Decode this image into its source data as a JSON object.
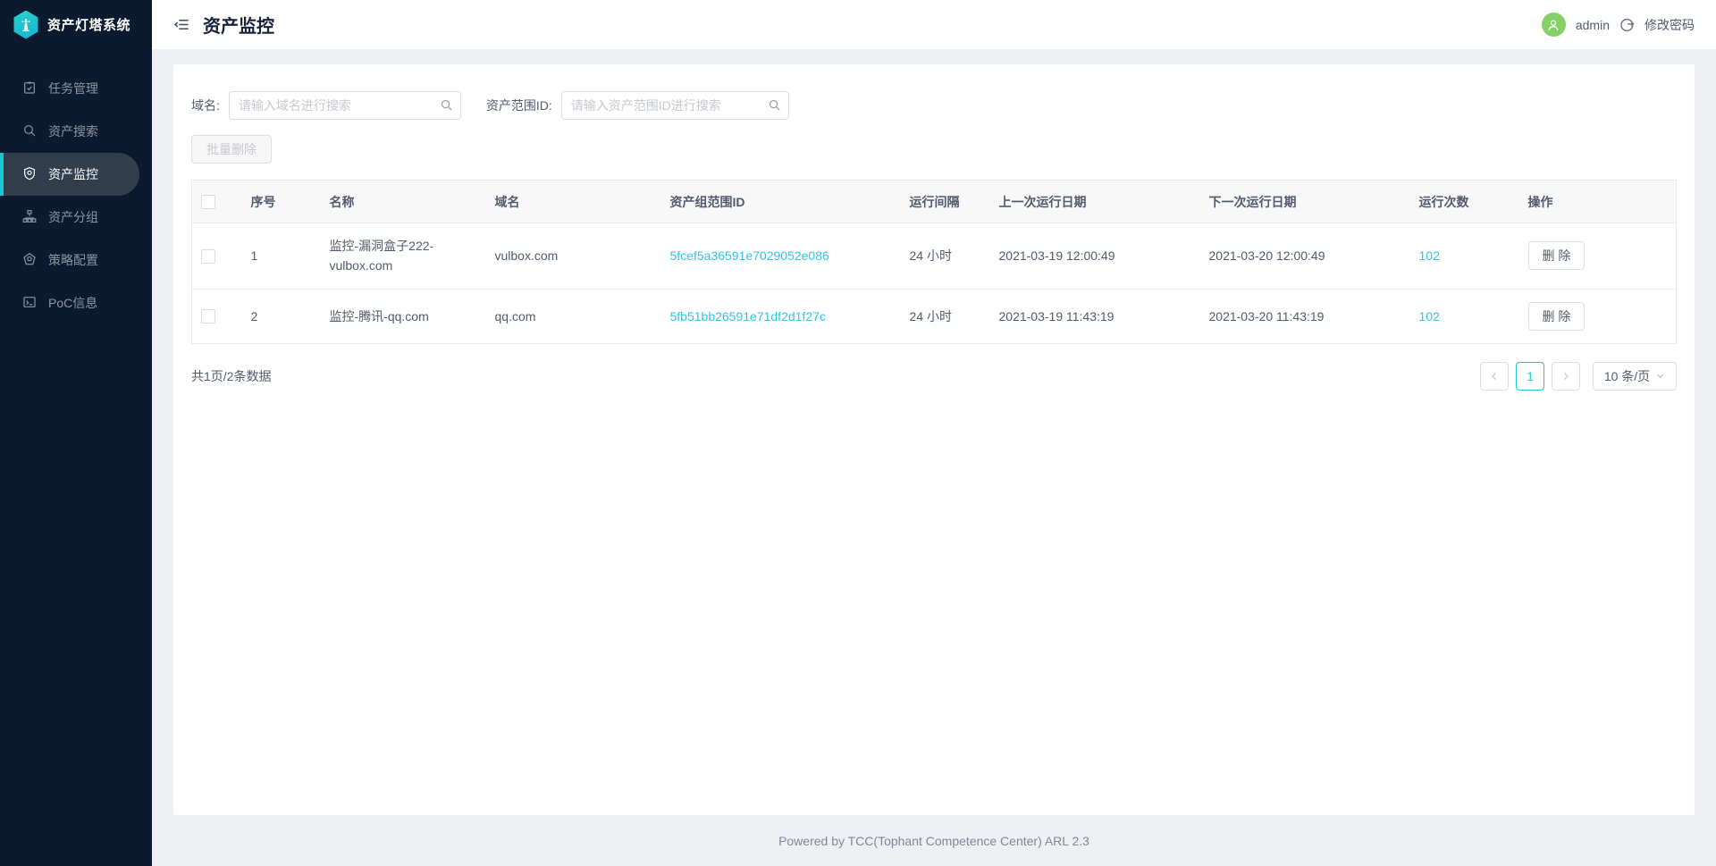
{
  "app": {
    "name": "资产灯塔系统"
  },
  "sidebar": {
    "items": [
      {
        "label": "任务管理",
        "icon": "clipboard-check-icon",
        "active": false
      },
      {
        "label": "资产搜索",
        "icon": "search-icon",
        "active": false
      },
      {
        "label": "资产监控",
        "icon": "shield-icon",
        "active": true
      },
      {
        "label": "资产分组",
        "icon": "org-chart-icon",
        "active": false
      },
      {
        "label": "策略配置",
        "icon": "pentagon-seal-icon",
        "active": false
      },
      {
        "label": "PoC信息",
        "icon": "terminal-icon",
        "active": false
      }
    ]
  },
  "header": {
    "title": "资产监控",
    "username": "admin",
    "change_password": "修改密码"
  },
  "filters": {
    "domain_label": "域名:",
    "domain_placeholder": "请输入域名进行搜索",
    "scope_label": "资产范围ID:",
    "scope_placeholder": "请输入资产范围ID进行搜索"
  },
  "toolbar": {
    "batch_delete_label": "批量删除"
  },
  "table": {
    "columns": {
      "index": "序号",
      "name": "名称",
      "domain": "域名",
      "scope_id": "资产组范围ID",
      "interval": "运行间隔",
      "last_run": "上一次运行日期",
      "next_run": "下一次运行日期",
      "run_count": "运行次数",
      "actions": "操作"
    },
    "rows": [
      {
        "index": "1",
        "name": "监控-漏洞盒子222-vulbox.com",
        "domain": "vulbox.com",
        "scope_id": "5fcef5a36591e7029052e086",
        "interval": "24 小时",
        "last_run": "2021-03-19 12:00:49",
        "next_run": "2021-03-20 12:00:49",
        "run_count": "102"
      },
      {
        "index": "2",
        "name": "监控-腾讯-qq.com",
        "domain": "qq.com",
        "scope_id": "5fb51bb26591e71df2d1f27c",
        "interval": "24 小时",
        "last_run": "2021-03-19 11:43:19",
        "next_run": "2021-03-20 11:43:19",
        "run_count": "102"
      }
    ],
    "delete_label": "删 除"
  },
  "pagination": {
    "summary": "共1页/2条数据",
    "current_page": "1",
    "page_size": "10 条/页"
  },
  "footer": {
    "text": "Powered by TCC(Tophant Competence Center) ARL 2.3"
  },
  "icons": {
    "logo": "lighthouse-hexagon-icon",
    "collapse": "menu-fold-icon",
    "user": "person-icon",
    "logout": "logout-icon",
    "search": "search-icon",
    "pager_prev": "chevron-left-icon",
    "pager_next": "chevron-right-icon",
    "select": "chevron-down-icon"
  },
  "colors": {
    "accent": "#1bc5d4",
    "link": "#33c3e8",
    "sidebar_bg": "#0b1a2e",
    "sidebar_active_bg": "#323e4c",
    "avatar_green": "#87d068",
    "content_bg": "#eef0f3"
  }
}
